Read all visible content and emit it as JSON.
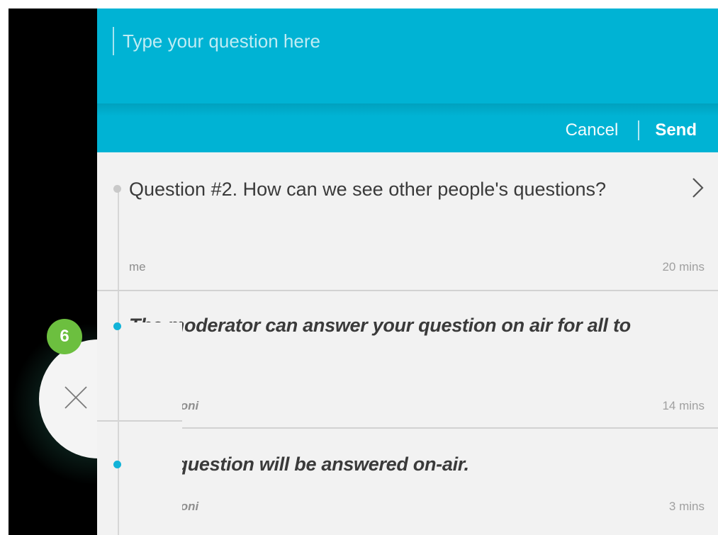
{
  "compose": {
    "placeholder": "Type your question here",
    "cancel_label": "Cancel",
    "send_label": "Send"
  },
  "thread": {
    "question": {
      "text": "Question #2.  How can we see other people's questions?",
      "author": "me",
      "time": "20 mins"
    },
    "answers": [
      {
        "text": "The moderator can answer your question on air for all to see.",
        "author": "debbie.zioni",
        "time": "14 mins"
      },
      {
        "text": "Your question will be answered on-air.",
        "author": "debbie.zioni",
        "time": "3 mins"
      }
    ]
  },
  "widget": {
    "badge_count": "6",
    "close_icon": "close-icon"
  },
  "colors": {
    "accent": "#00b3d4",
    "answer_dot": "#12b3d8",
    "badge": "#6cbf3f",
    "panel_bg": "#f2f2f2"
  }
}
